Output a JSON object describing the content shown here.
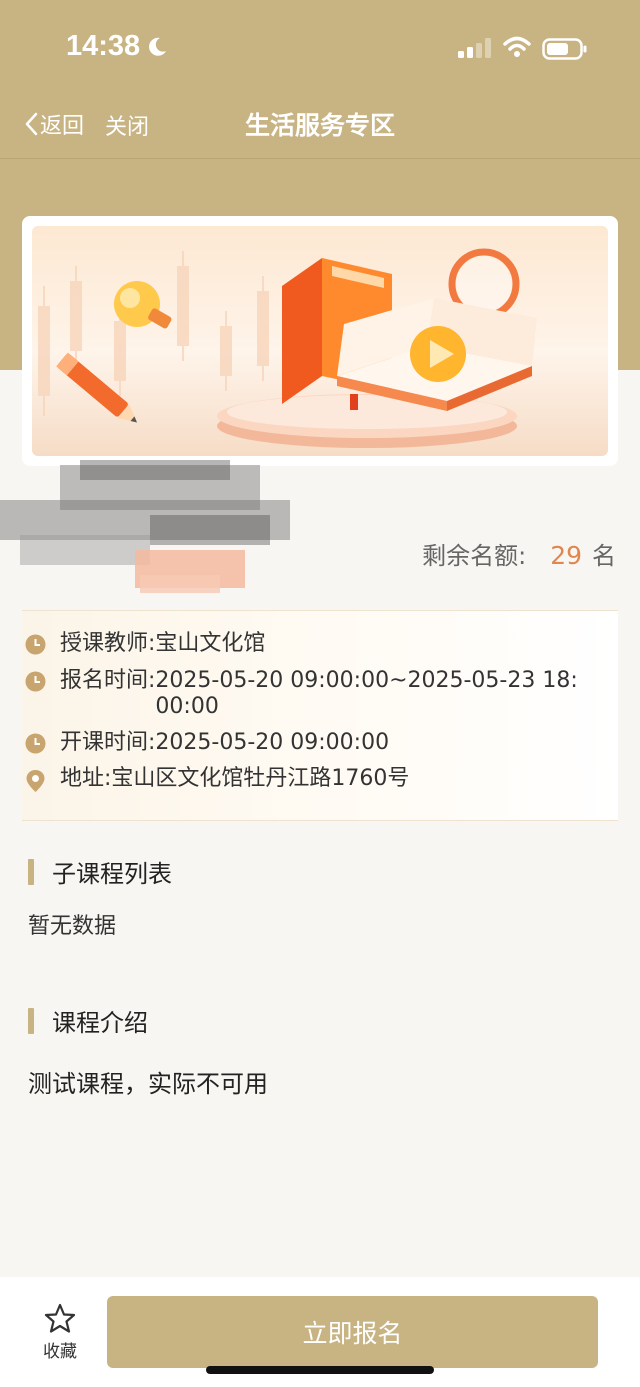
{
  "status_bar": {
    "time": "14:38"
  },
  "nav": {
    "back_label": "返回",
    "close_label": "关闭",
    "title": "生活服务专区"
  },
  "course": {
    "quota_label": "剩余名额:",
    "quota_count": "29",
    "quota_unit": "名"
  },
  "info": {
    "teacher_label": "授课教师:",
    "teacher_value": "宝山文化馆",
    "signup_time_label": "报名时间:",
    "signup_time_value": "2025-05-20 09:00:00~2025-05-23 18:00:00",
    "start_time_label": "开课时间:",
    "start_time_value": "2025-05-20 09:00:00",
    "address_label": "地址:",
    "address_value": "宝山区文化馆牡丹江路1760号"
  },
  "sub_courses": {
    "title": "子课程列表",
    "empty_text": "暂无数据"
  },
  "intro": {
    "title": "课程介绍",
    "text": "测试课程，实际不可用"
  },
  "bottom": {
    "favorite_label": "收藏",
    "signup_label": "立即报名"
  },
  "colors": {
    "brand": "#c8b383",
    "accent": "#e0864f",
    "banner_orange": "#f07a2c"
  },
  "icons": [
    "moon-icon",
    "signal-icon",
    "wifi-icon",
    "battery-icon",
    "chevron-left-icon",
    "clock-icon",
    "location-pin-icon",
    "star-icon"
  ]
}
